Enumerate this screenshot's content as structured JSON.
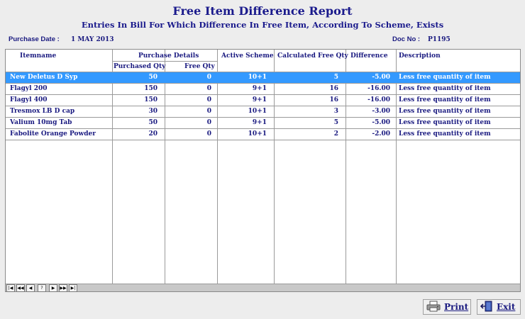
{
  "report": {
    "title": "Free Item Difference Report",
    "subtitle": "Entries In Bill For Which Difference In Free Item, According To Scheme, Exists",
    "purchase_date_label": "Purchase Date :",
    "purchase_date_value": "1 MAY 2013",
    "doc_no_label": "Doc No :",
    "doc_no_value": "P1195"
  },
  "table": {
    "headers": {
      "itemname": "Itemname",
      "purchase_details": "Purchase Details",
      "purchased_qty": "Purchased Qty",
      "free_qty": "Free Qty",
      "active_scheme": "Active  Scheme",
      "calculated_free_qty": "Calculated Free Qty",
      "difference": "Difference",
      "description": "Description"
    },
    "rows": [
      {
        "item": "New Deletus D Syp",
        "purchased": "50",
        "free": "0",
        "scheme": "10+1",
        "calc": "5",
        "diff": "-5.00",
        "desc": "Less free quantity of item"
      },
      {
        "item": "Flagyl 200",
        "purchased": "150",
        "free": "0",
        "scheme": "9+1",
        "calc": "16",
        "diff": "-16.00",
        "desc": "Less free quantity of item"
      },
      {
        "item": "Flagyl 400",
        "purchased": "150",
        "free": "0",
        "scheme": "9+1",
        "calc": "16",
        "diff": "-16.00",
        "desc": "Less free quantity of item"
      },
      {
        "item": "Tresmox LB D cap",
        "purchased": "30",
        "free": "0",
        "scheme": "10+1",
        "calc": "3",
        "diff": "-3.00",
        "desc": "Less free quantity of item"
      },
      {
        "item": "Valium 10mg Tab",
        "purchased": "50",
        "free": "0",
        "scheme": "9+1",
        "calc": "5",
        "diff": "-5.00",
        "desc": "Less free quantity of item"
      },
      {
        "item": "Fabolite Orange Powder",
        "purchased": "20",
        "free": "0",
        "scheme": "10+1",
        "calc": "2",
        "diff": "-2.00",
        "desc": "Less free quantity of item"
      }
    ]
  },
  "navigator": {
    "first": "|◀",
    "prev_page": "◀◀",
    "prev": "◀",
    "help": "?",
    "next": "▶",
    "next_page": "▶▶",
    "last": "▶|"
  },
  "buttons": {
    "print": "Print",
    "exit": "Exit"
  },
  "colors": {
    "selected_row": "#3399ff",
    "text": "#1a1a80",
    "background": "#ededed"
  }
}
